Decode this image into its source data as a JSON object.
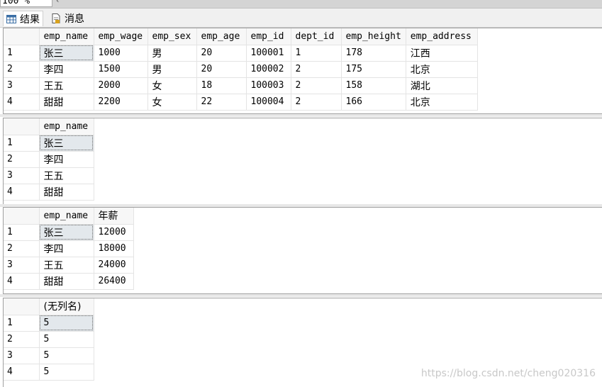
{
  "toolbar": {
    "zoom_value": "100 %"
  },
  "tabs": [
    {
      "label": "结果",
      "icon": "grid-icon"
    },
    {
      "label": "消息",
      "icon": "document-icon"
    }
  ],
  "results": [
    {
      "columns": [
        "emp_name",
        "emp_wage",
        "emp_sex",
        "emp_age",
        "emp_id",
        "dept_id",
        "emp_height",
        "emp_address"
      ],
      "rows": [
        [
          "1",
          "张三",
          "1000",
          "男",
          "20",
          "100001",
          "1",
          "178",
          "江西"
        ],
        [
          "2",
          "李四",
          "1500",
          "男",
          "20",
          "100002",
          "2",
          "175",
          "北京"
        ],
        [
          "3",
          "王五",
          "2000",
          "女",
          "18",
          "100003",
          "2",
          "158",
          "湖北"
        ],
        [
          "4",
          "甜甜",
          "2200",
          "女",
          "22",
          "100004",
          "2",
          "166",
          "北京"
        ]
      ]
    },
    {
      "columns": [
        "emp_name"
      ],
      "rows": [
        [
          "1",
          "张三"
        ],
        [
          "2",
          "李四"
        ],
        [
          "3",
          "王五"
        ],
        [
          "4",
          "甜甜"
        ]
      ]
    },
    {
      "columns": [
        "emp_name",
        "年薪"
      ],
      "rows": [
        [
          "1",
          "张三",
          "12000"
        ],
        [
          "2",
          "李四",
          "18000"
        ],
        [
          "3",
          "王五",
          "24000"
        ],
        [
          "4",
          "甜甜",
          "26400"
        ]
      ]
    },
    {
      "columns": [
        "(无列名)"
      ],
      "rows": [
        [
          "1",
          "5"
        ],
        [
          "2",
          "5"
        ],
        [
          "3",
          "5"
        ],
        [
          "4",
          "5"
        ]
      ]
    }
  ],
  "watermark": "https://blog.csdn.net/cheng020316"
}
